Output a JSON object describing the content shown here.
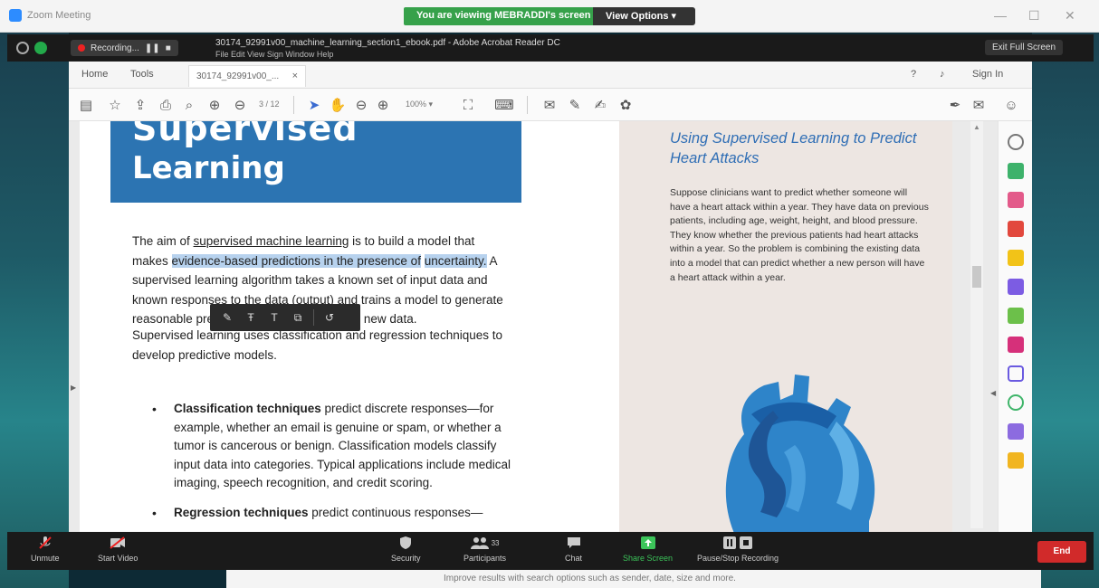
{
  "zoom": {
    "window_title": "Zoom Meeting",
    "viewing_banner": "You are viewing MEBRADDI's screen",
    "view_options": "View Options",
    "view_options_caret": "▾",
    "recording_label": "Recording...",
    "exit_fullscreen": "Exit Full Screen",
    "bottom": {
      "unmute": "Unmute",
      "start_video": "Start Video",
      "security": "Security",
      "participants": "Participants",
      "participants_count": "33",
      "chat": "Chat",
      "share_screen": "Share Screen",
      "pause_stop": "Pause/Stop Recording",
      "end": "End"
    },
    "under_bar_text": "Improve results with search options such as sender, date, size and more."
  },
  "acrobat": {
    "title": "30174_92991v00_machine_learning_section1_ebook.pdf - Adobe Acrobat Reader DC",
    "menu": "File  Edit  View  Sign  Window  Help",
    "tabs": {
      "home": "Home",
      "tools": "Tools",
      "doc_tab": "30174_92991v00_...",
      "close_glyph": "×",
      "sign_in": "Sign In"
    },
    "toolbar": {
      "page_indicator": "3 / 12",
      "zoom": "100%",
      "zoom_caret": "▾"
    }
  },
  "document": {
    "hero_top": "Supervised",
    "hero_title": "Learning",
    "para1_a": "The aim of ",
    "para1_b": "supervised machine learning",
    "para1_c": " is to build a model",
    "para1_d": "that makes ",
    "para1_e": "evidence-based predictions in the presence of",
    "para1_f": "uncertainty.",
    "para1_g": " A supervised learning algorithm takes a known set of input data and known responses to the data (output) and trains a model to generate reasonable predictions for the response to new data.",
    "para2": "Supervised learning uses classification and regression techniques to develop predictive models.",
    "bullet1_bold": "Classification techniques",
    "bullet1_text": " predict discrete responses—for example, whether an email is genuine or spam, or whether a tumor is cancerous or benign. Classification models classify input data into categories. Typical applications include medical imaging, speech recognition, and credit scoring.",
    "bullet2_bold": "Regression techniques",
    "bullet2_text": " predict continuous responses—",
    "side_title": "Using Supervised Learning to Predict Heart Attacks",
    "side_body": "Suppose clinicians want to predict whether someone will have a heart attack within a year. They have data on previous patients, including age, weight, height, and blood pressure. They know whether the previous patients had heart attacks within a year. So the problem is combining the existing data into a model that can predict whether a new person will have a heart attack within a year."
  },
  "colors": {
    "hero_blue": "#2c74b2",
    "side_panel": "#ede6e2",
    "highlight": "#b7d2ee",
    "zoom_green": "#36a14a",
    "end_red": "#d12a2a"
  }
}
